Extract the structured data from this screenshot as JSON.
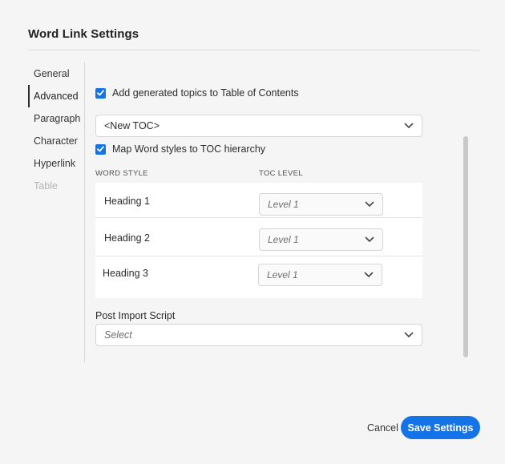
{
  "dialog": {
    "title": "Word Link Settings"
  },
  "sidebar": {
    "items": [
      {
        "label": "General",
        "state": "normal"
      },
      {
        "label": "Advanced",
        "state": "active"
      },
      {
        "label": "Paragraph",
        "state": "normal"
      },
      {
        "label": "Character",
        "state": "normal"
      },
      {
        "label": "Hyperlink",
        "state": "normal"
      },
      {
        "label": "Table",
        "state": "disabled"
      }
    ]
  },
  "advanced": {
    "add_topics_checkbox": {
      "label": "Add generated topics to Table of Contents",
      "checked": true
    },
    "toc_select": {
      "value": "<New TOC>"
    },
    "map_styles_checkbox": {
      "label": "Map Word styles to TOC hierarchy",
      "checked": true
    },
    "table": {
      "headers": {
        "word_style": "WORD STYLE",
        "toc_level": "TOC LEVEL"
      },
      "rows": [
        {
          "style": "Heading 1",
          "level": "Level 1"
        },
        {
          "style": "Heading 2",
          "level": "Level 1"
        },
        {
          "style": "Heading 3",
          "level": "Level 1"
        }
      ]
    },
    "post_import": {
      "label": "Post Import Script",
      "placeholder": "Select"
    }
  },
  "footer": {
    "cancel_label": "Cancel",
    "save_label": "Save Settings"
  },
  "colors": {
    "accent": "#1473e6",
    "background": "#f5f5f5",
    "surface": "#ffffff"
  }
}
